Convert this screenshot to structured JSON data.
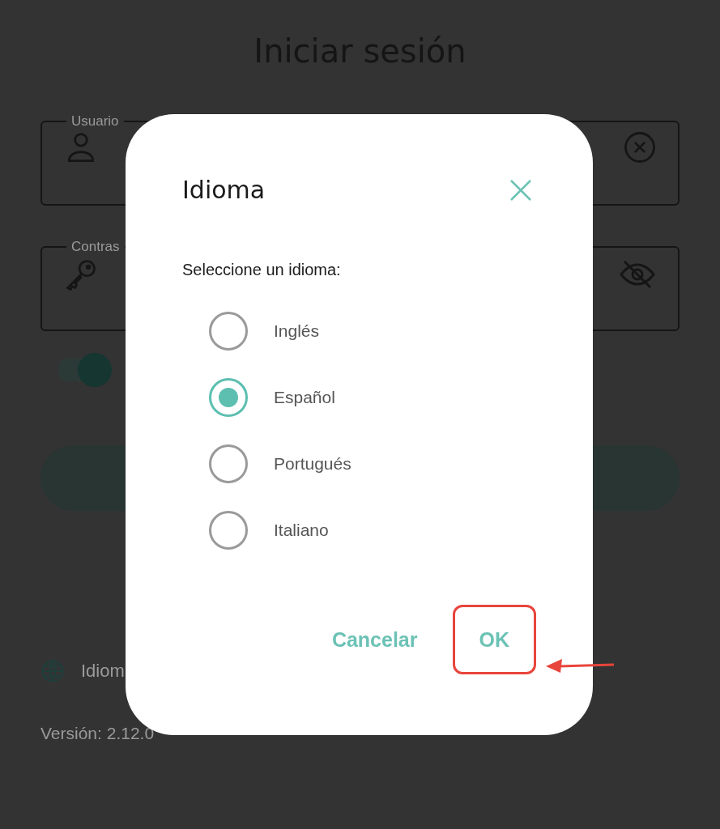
{
  "page": {
    "title": "Iniciar sesión",
    "fields": [
      {
        "kind": "user",
        "legend": "Usuario"
      },
      {
        "kind": "password",
        "legend": "Contras"
      }
    ],
    "switch": {
      "on": true
    },
    "language_link": "Idiom",
    "version": "Versión: 2.12.0"
  },
  "dialog": {
    "title": "Idioma",
    "prompt": "Seleccione un idioma:",
    "options": [
      {
        "label": "Inglés",
        "selected": false
      },
      {
        "label": "Español",
        "selected": true
      },
      {
        "label": "Portugués",
        "selected": false
      },
      {
        "label": "Italiano",
        "selected": false
      }
    ],
    "buttons": [
      {
        "label": "Cancelar",
        "highlighted": false
      },
      {
        "label": "OK",
        "highlighted": true
      }
    ]
  }
}
